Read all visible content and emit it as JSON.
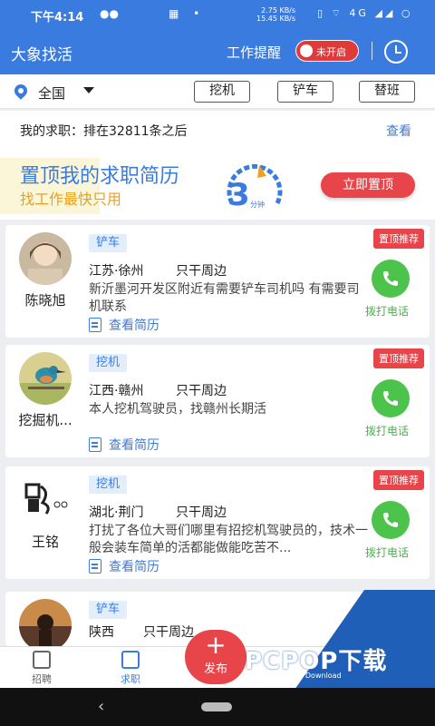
{
  "status_bar": {
    "time": "下午4:14",
    "speed_up": "2.75 KB/s",
    "speed_down": "15.45 KB/s",
    "network": "4G"
  },
  "app_bar": {
    "title": "大象找活",
    "remind_label": "工作提醒",
    "toggle_label": "未开启"
  },
  "filter": {
    "region": "全国",
    "chips": [
      "挖机",
      "铲车",
      "替班"
    ]
  },
  "my_job": {
    "status": "我的求职：排在32811条之后",
    "view": "查看",
    "promo_title": "置顶我的求职简历",
    "promo_sub": "找工作最快只用",
    "gauge_number": "3",
    "gauge_unit": "分钟",
    "pin_button": "立即置顶"
  },
  "listings": [
    {
      "name": "陈晓旭",
      "tag": "铲车",
      "location": "江苏·徐州",
      "range": "只干周边",
      "description": "新沂墨河开发区附近有需要铲车司机吗 有需要司机联系",
      "resume": "查看简历",
      "badge": "置顶推荐",
      "call": "拨打电话"
    },
    {
      "name": "挖掘机...",
      "tag": "挖机",
      "location": "江西·赣州",
      "range": "只干周边",
      "description": "本人挖机驾驶员，找赣州长期活",
      "resume": "查看简历",
      "badge": "置顶推荐",
      "call": "拨打电话"
    },
    {
      "name": "王铭",
      "tag": "挖机",
      "location": "湖北·荆门",
      "range": "只干周边",
      "description": "打扰了各位大哥们哪里有招挖机驾驶员的，技术一般会装车简单的活都能做能吃苦不...",
      "resume": "查看简历",
      "badge": "置顶推荐",
      "call": "拨打电话"
    },
    {
      "name": "",
      "tag": "铲车",
      "location": "陕西",
      "range": "只干周边",
      "description": "",
      "resume": "",
      "badge": "",
      "call": ""
    }
  ],
  "tab_bar": {
    "tabs": [
      "招聘",
      "求职",
      "",
      "",
      ""
    ],
    "publish": "发布"
  },
  "watermark": {
    "brand": "PCPOP下载",
    "sub": "PCPOP Download"
  },
  "colors": {
    "primary": "#3a7be0",
    "accent_red": "#e8454a",
    "call_green": "#4cc34a"
  }
}
